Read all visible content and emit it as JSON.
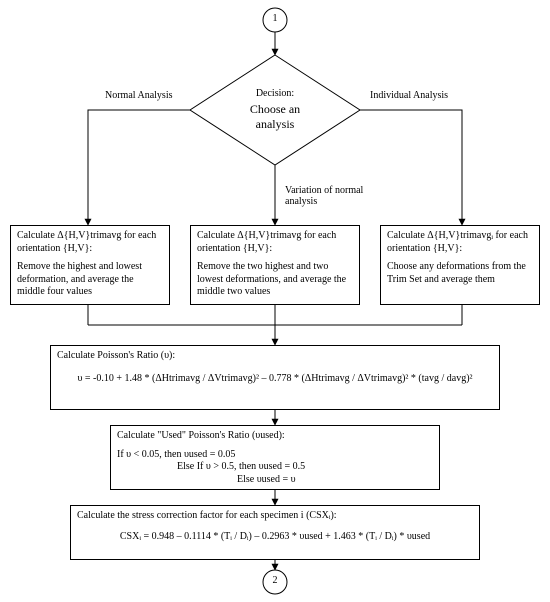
{
  "connector": {
    "top": "1",
    "bottom": "2"
  },
  "decision": {
    "title": "Decision:",
    "line1": "Choose an",
    "line2": "analysis"
  },
  "branches": {
    "left": "Normal Analysis",
    "mid": "Variation of normal analysis",
    "right": "Individual Analysis"
  },
  "boxes": {
    "left": {
      "l1": "Calculate  Δ{H,V}trimavg for each orientation {H,V}:",
      "l2": "Remove the highest and lowest deformation, and average the middle four values"
    },
    "mid": {
      "l1": "Calculate  Δ{H,V}trimavg for each orientation {H,V}:",
      "l2": "Remove the two highest and two lowest deformations, and average the middle two values"
    },
    "right": {
      "l1": "Calculate  Δ{H,V}trimavgᵢ for each orientation {H,V}:",
      "l2": "Choose any deformations from the Trim Set and average them"
    },
    "poisson": {
      "t": "Calculate Poisson's Ratio (υ):",
      "f": "υ = -0.10 + 1.48 * (ΔHtrimavg / ΔVtrimavg)² – 0.778 * (ΔHtrimavg / ΔVtrimavg)² * (tavg / davg)²"
    },
    "used": {
      "t": "Calculate \"Used\" Poisson's Ratio (υused):",
      "l1": "If υ < 0.05, then υused = 0.05",
      "l2": "Else If υ > 0.5, then υused = 0.5",
      "l3": "Else υused = υ"
    },
    "csx": {
      "t": "Calculate the stress correction factor for each specimen i (CSXᵢ):",
      "f": "CSXᵢ = 0.948 – 0.1114 * (Tᵢ / Dᵢ) – 0.2963 * υused + 1.463 * (Tᵢ / Dᵢ) * υused"
    }
  }
}
